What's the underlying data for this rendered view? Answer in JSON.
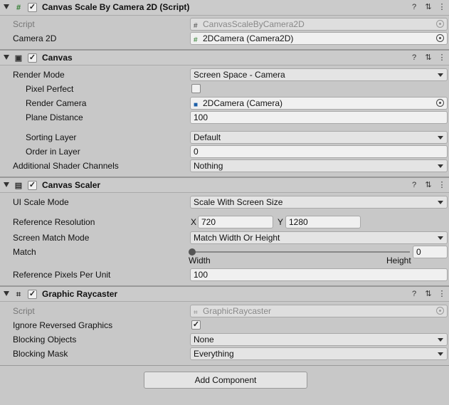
{
  "sections": {
    "camera_script": {
      "icon": "hash-icon",
      "enabled": true,
      "title": "Canvas Scale By Camera 2D (Script)",
      "script_label": "Script",
      "script_value": "CanvasScaleByCamera2D",
      "camera_label": "Camera 2D",
      "camera_value": "2DCamera (Camera2D)"
    },
    "canvas": {
      "icon": "canvas-icon",
      "enabled": true,
      "title": "Canvas",
      "render_mode_label": "Render Mode",
      "render_mode_value": "Screen Space - Camera",
      "pixel_perfect_label": "Pixel Perfect",
      "pixel_perfect_checked": false,
      "render_camera_label": "Render Camera",
      "render_camera_value": "2DCamera (Camera)",
      "plane_distance_label": "Plane Distance",
      "plane_distance_value": "100",
      "sorting_layer_label": "Sorting Layer",
      "sorting_layer_value": "Default",
      "order_label": "Order in Layer",
      "order_value": "0",
      "shader_channels_label": "Additional Shader Channels",
      "shader_channels_value": "Nothing"
    },
    "canvas_scaler": {
      "icon": "scaler-icon",
      "enabled": true,
      "title": "Canvas Scaler",
      "scale_mode_label": "UI Scale Mode",
      "scale_mode_value": "Scale With Screen Size",
      "ref_res_label": "Reference Resolution",
      "ref_res_x_label": "X",
      "ref_res_x_value": "720",
      "ref_res_y_label": "Y",
      "ref_res_y_value": "1280",
      "match_mode_label": "Screen Match Mode",
      "match_mode_value": "Match Width Or Height",
      "match_label": "Match",
      "match_value": "0",
      "match_fraction": 0,
      "match_left_label": "Width",
      "match_right_label": "Height",
      "ppu_label": "Reference Pixels Per Unit",
      "ppu_value": "100"
    },
    "raycaster": {
      "icon": "raycaster-icon",
      "enabled": true,
      "title": "Graphic Raycaster",
      "script_label": "Script",
      "script_value": "GraphicRaycaster",
      "ignore_reversed_label": "Ignore Reversed Graphics",
      "ignore_reversed_checked": true,
      "blocking_objects_label": "Blocking Objects",
      "blocking_objects_value": "None",
      "blocking_mask_label": "Blocking Mask",
      "blocking_mask_value": "Everything"
    }
  },
  "add_component_label": "Add Component",
  "header_icons": {
    "help": "?",
    "presets": "⇅",
    "menu": "⋮"
  }
}
